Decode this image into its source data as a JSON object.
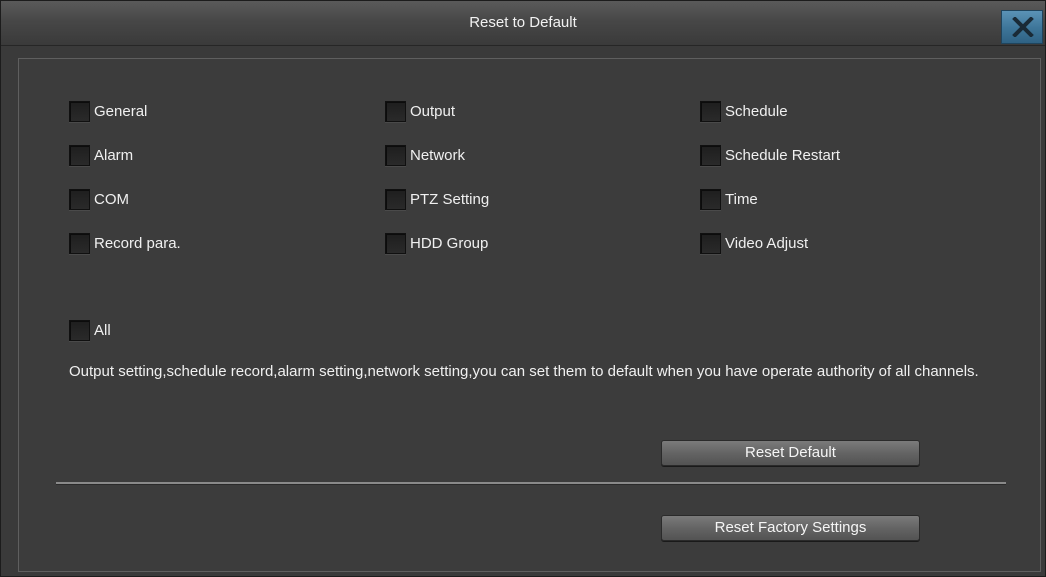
{
  "dialog": {
    "title": "Reset to Default",
    "close_icon": "close-x-icon"
  },
  "options": {
    "general": "General",
    "output": "Output",
    "schedule": "Schedule",
    "alarm": "Alarm",
    "network": "Network",
    "schedule_restart": "Schedule Restart",
    "com": "COM",
    "ptz_setting": "PTZ Setting",
    "time": "Time",
    "record_para": "Record para.",
    "hdd_group": "HDD Group",
    "video_adjust": "Video Adjust",
    "all": "All"
  },
  "description": "Output setting,schedule record,alarm setting,network setting,you can set them to default when you have operate authority of all channels.",
  "buttons": {
    "reset_default": "Reset Default",
    "reset_factory": "Reset Factory Settings"
  },
  "colors": {
    "close_button": "#3f779b",
    "background": "#3a3a3a"
  }
}
